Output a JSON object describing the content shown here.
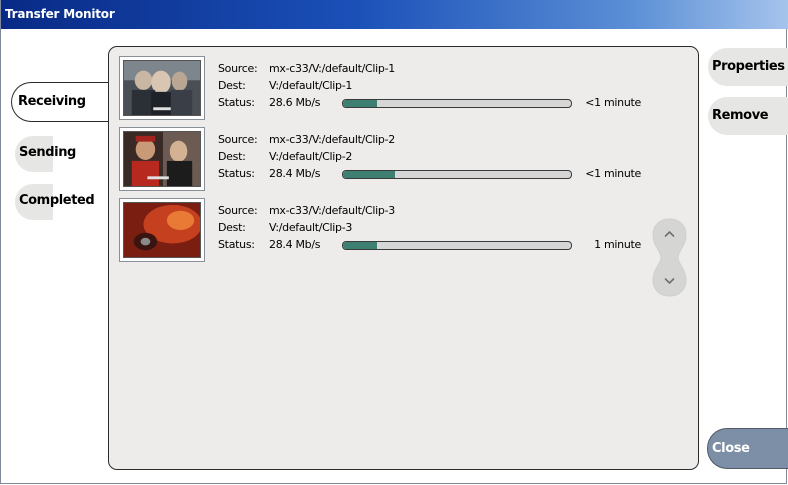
{
  "window": {
    "title": "Transfer Monitor"
  },
  "tabs": [
    {
      "label": "Receiving",
      "active": true
    },
    {
      "label": "Sending",
      "active": false
    },
    {
      "label": "Completed",
      "active": false
    }
  ],
  "labels": {
    "source": "Source:",
    "dest": "Dest:",
    "status": "Status:"
  },
  "transfers": [
    {
      "source": "mx-c33/V:/default/Clip-1",
      "dest": "V:/default/Clip-1",
      "rate": "28.6 Mb/s",
      "eta": "<1 minute",
      "progress_fraction": 0.15,
      "thumbnail": "clip-1-thumbnail"
    },
    {
      "source": "mx-c33/V:/default/Clip-2",
      "dest": "V:/default/Clip-2",
      "rate": "28.4 Mb/s",
      "eta": "<1 minute",
      "progress_fraction": 0.23,
      "thumbnail": "clip-2-thumbnail"
    },
    {
      "source": "mx-c33/V:/default/Clip-3",
      "dest": "V:/default/Clip-3",
      "rate": "28.4 Mb/s",
      "eta": "1 minute",
      "progress_fraction": 0.15,
      "thumbnail": "clip-3-thumbnail"
    }
  ],
  "side_buttons": {
    "properties": "Properties",
    "remove": "Remove",
    "close": "Close"
  },
  "icons": {
    "scroll_up": "chevron-up-icon",
    "scroll_down": "chevron-down-icon"
  },
  "colors": {
    "progress_fill": "#3d8072",
    "close_button": "#7d8fa6",
    "titlebar": "#1b50b8"
  }
}
